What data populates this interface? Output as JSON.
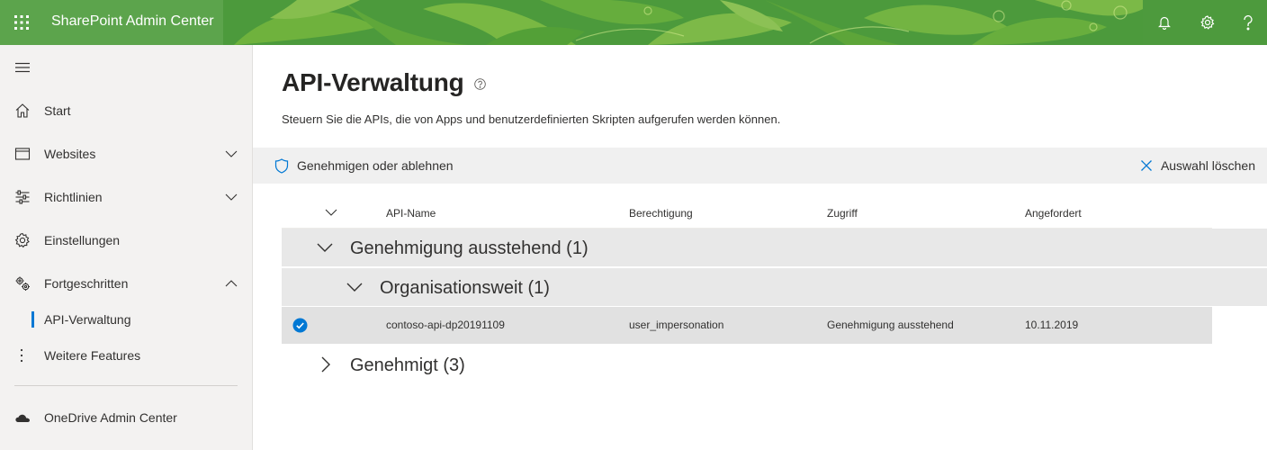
{
  "header": {
    "app_title": "SharePoint Admin Center",
    "icons": [
      "app-launcher-icon",
      "bell-icon",
      "gear-icon",
      "help-icon"
    ]
  },
  "sidebar": {
    "items": [
      {
        "label": "Start",
        "icon": "home-icon"
      },
      {
        "label": "Websites",
        "icon": "window-icon",
        "expandable": true,
        "expanded": false
      },
      {
        "label": "Richtlinien",
        "icon": "sliders-icon",
        "expandable": true,
        "expanded": false
      },
      {
        "label": "Einstellungen",
        "icon": "gear-icon"
      },
      {
        "label": "Fortgeschritten",
        "icon": "gears-icon",
        "expandable": true,
        "expanded": true
      }
    ],
    "subitems": [
      {
        "label": "API-Verwaltung",
        "selected": true
      },
      {
        "label": "Weitere Features",
        "icon": "more-vertical-icon"
      }
    ],
    "footer_item": {
      "label": "OneDrive Admin Center",
      "icon": "cloud-icon"
    }
  },
  "main": {
    "title": "API-Verwaltung",
    "description": "Steuern Sie die APIs, die von Apps und benutzerdefinierten Skripten aufgerufen werden können.",
    "commands": {
      "approve_label": "Genehmigen oder ablehnen",
      "clear_label": "Auswahl löschen"
    },
    "columns": [
      "API-Name",
      "Berechtigung",
      "Zugriff",
      "Angefordert"
    ],
    "groups": {
      "pending": {
        "label": "Genehmigung ausstehend (1)",
        "expanded": true
      },
      "org_wide": {
        "label": "Organisationsweit (1)",
        "expanded": true
      },
      "approved": {
        "label": "Genehmigt (3)",
        "expanded": false
      }
    },
    "rows": [
      {
        "selected": true,
        "api_name": "contoso-api-dp20191109",
        "permission": "user_impersonation",
        "access": "Genehmigung ausstehend",
        "requested": "10.11.2019"
      }
    ]
  },
  "colors": {
    "header_green": "#4a9c3a",
    "accent": "#0078d4",
    "nav_bg": "#f3f2f1",
    "group_bg": "#e8e8e8",
    "selected_row_bg": "#e1e1e1"
  }
}
